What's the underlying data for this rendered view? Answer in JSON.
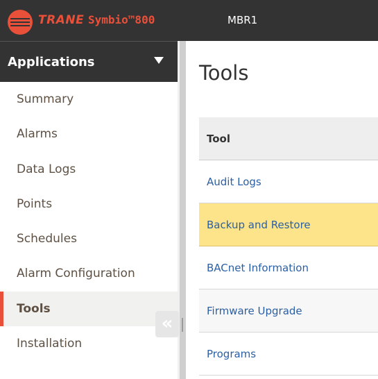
{
  "header": {
    "brand": "TRANE",
    "product": "Symbio™800",
    "device_name": "MBR1"
  },
  "sidebar": {
    "title": "Applications",
    "items": [
      {
        "label": "Summary"
      },
      {
        "label": "Alarms"
      },
      {
        "label": "Data Logs"
      },
      {
        "label": "Points"
      },
      {
        "label": "Schedules"
      },
      {
        "label": "Alarm Configuration"
      },
      {
        "label": "Tools",
        "active": true
      },
      {
        "label": "Installation"
      }
    ],
    "collapse_glyph": "«"
  },
  "main": {
    "title": "Tools",
    "table": {
      "header": "Tool",
      "rows": [
        {
          "label": "Audit Logs"
        },
        {
          "label": "Backup and Restore",
          "selected": true
        },
        {
          "label": "BACnet Information"
        },
        {
          "label": "Firmware Upgrade"
        },
        {
          "label": "Programs"
        }
      ]
    }
  },
  "colors": {
    "brand": "#e8503a",
    "header_bg": "#333333",
    "selected_row": "#fde48a",
    "link": "#2b5fa3"
  }
}
